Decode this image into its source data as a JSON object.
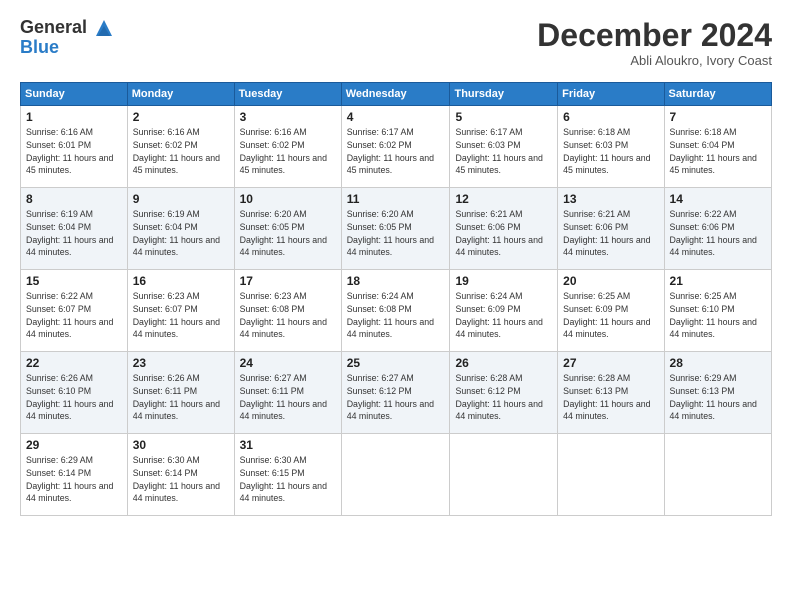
{
  "logo": {
    "line1": "General",
    "line2": "Blue"
  },
  "header": {
    "month": "December 2024",
    "location": "Abli Aloukro, Ivory Coast"
  },
  "weekdays": [
    "Sunday",
    "Monday",
    "Tuesday",
    "Wednesday",
    "Thursday",
    "Friday",
    "Saturday"
  ],
  "weeks": [
    [
      {
        "day": "1",
        "info": "Sunrise: 6:16 AM\nSunset: 6:01 PM\nDaylight: 11 hours and 45 minutes."
      },
      {
        "day": "2",
        "info": "Sunrise: 6:16 AM\nSunset: 6:02 PM\nDaylight: 11 hours and 45 minutes."
      },
      {
        "day": "3",
        "info": "Sunrise: 6:16 AM\nSunset: 6:02 PM\nDaylight: 11 hours and 45 minutes."
      },
      {
        "day": "4",
        "info": "Sunrise: 6:17 AM\nSunset: 6:02 PM\nDaylight: 11 hours and 45 minutes."
      },
      {
        "day": "5",
        "info": "Sunrise: 6:17 AM\nSunset: 6:03 PM\nDaylight: 11 hours and 45 minutes."
      },
      {
        "day": "6",
        "info": "Sunrise: 6:18 AM\nSunset: 6:03 PM\nDaylight: 11 hours and 45 minutes."
      },
      {
        "day": "7",
        "info": "Sunrise: 6:18 AM\nSunset: 6:04 PM\nDaylight: 11 hours and 45 minutes."
      }
    ],
    [
      {
        "day": "8",
        "info": "Sunrise: 6:19 AM\nSunset: 6:04 PM\nDaylight: 11 hours and 44 minutes."
      },
      {
        "day": "9",
        "info": "Sunrise: 6:19 AM\nSunset: 6:04 PM\nDaylight: 11 hours and 44 minutes."
      },
      {
        "day": "10",
        "info": "Sunrise: 6:20 AM\nSunset: 6:05 PM\nDaylight: 11 hours and 44 minutes."
      },
      {
        "day": "11",
        "info": "Sunrise: 6:20 AM\nSunset: 6:05 PM\nDaylight: 11 hours and 44 minutes."
      },
      {
        "day": "12",
        "info": "Sunrise: 6:21 AM\nSunset: 6:06 PM\nDaylight: 11 hours and 44 minutes."
      },
      {
        "day": "13",
        "info": "Sunrise: 6:21 AM\nSunset: 6:06 PM\nDaylight: 11 hours and 44 minutes."
      },
      {
        "day": "14",
        "info": "Sunrise: 6:22 AM\nSunset: 6:06 PM\nDaylight: 11 hours and 44 minutes."
      }
    ],
    [
      {
        "day": "15",
        "info": "Sunrise: 6:22 AM\nSunset: 6:07 PM\nDaylight: 11 hours and 44 minutes."
      },
      {
        "day": "16",
        "info": "Sunrise: 6:23 AM\nSunset: 6:07 PM\nDaylight: 11 hours and 44 minutes."
      },
      {
        "day": "17",
        "info": "Sunrise: 6:23 AM\nSunset: 6:08 PM\nDaylight: 11 hours and 44 minutes."
      },
      {
        "day": "18",
        "info": "Sunrise: 6:24 AM\nSunset: 6:08 PM\nDaylight: 11 hours and 44 minutes."
      },
      {
        "day": "19",
        "info": "Sunrise: 6:24 AM\nSunset: 6:09 PM\nDaylight: 11 hours and 44 minutes."
      },
      {
        "day": "20",
        "info": "Sunrise: 6:25 AM\nSunset: 6:09 PM\nDaylight: 11 hours and 44 minutes."
      },
      {
        "day": "21",
        "info": "Sunrise: 6:25 AM\nSunset: 6:10 PM\nDaylight: 11 hours and 44 minutes."
      }
    ],
    [
      {
        "day": "22",
        "info": "Sunrise: 6:26 AM\nSunset: 6:10 PM\nDaylight: 11 hours and 44 minutes."
      },
      {
        "day": "23",
        "info": "Sunrise: 6:26 AM\nSunset: 6:11 PM\nDaylight: 11 hours and 44 minutes."
      },
      {
        "day": "24",
        "info": "Sunrise: 6:27 AM\nSunset: 6:11 PM\nDaylight: 11 hours and 44 minutes."
      },
      {
        "day": "25",
        "info": "Sunrise: 6:27 AM\nSunset: 6:12 PM\nDaylight: 11 hours and 44 minutes."
      },
      {
        "day": "26",
        "info": "Sunrise: 6:28 AM\nSunset: 6:12 PM\nDaylight: 11 hours and 44 minutes."
      },
      {
        "day": "27",
        "info": "Sunrise: 6:28 AM\nSunset: 6:13 PM\nDaylight: 11 hours and 44 minutes."
      },
      {
        "day": "28",
        "info": "Sunrise: 6:29 AM\nSunset: 6:13 PM\nDaylight: 11 hours and 44 minutes."
      }
    ],
    [
      {
        "day": "29",
        "info": "Sunrise: 6:29 AM\nSunset: 6:14 PM\nDaylight: 11 hours and 44 minutes."
      },
      {
        "day": "30",
        "info": "Sunrise: 6:30 AM\nSunset: 6:14 PM\nDaylight: 11 hours and 44 minutes."
      },
      {
        "day": "31",
        "info": "Sunrise: 6:30 AM\nSunset: 6:15 PM\nDaylight: 11 hours and 44 minutes."
      },
      null,
      null,
      null,
      null
    ]
  ]
}
